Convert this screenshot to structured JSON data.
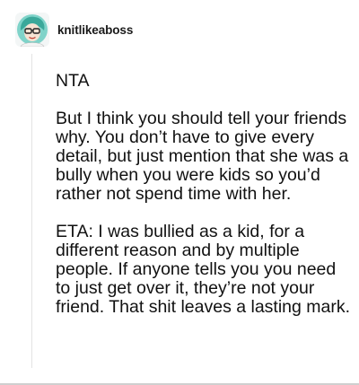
{
  "post": {
    "username": "knitlikeaboss",
    "avatar_icon": "avatar-illustration-icon",
    "paragraphs": [
      "NTA",
      "But I think you should tell your friends why. You don’t have to give every detail, but just mention that she was a bully when you were kids so you’d rather not spend time with her.",
      "ETA: I was bullied as a kid, for a different reason and by multiple people. If anyone tells you you need to just get over it, they’re not your friend. That shit leaves a lasting mark."
    ]
  },
  "colors": {
    "avatar_background": "#7fd3c9",
    "text": "#111111",
    "thread_line": "#e3e3e3"
  }
}
